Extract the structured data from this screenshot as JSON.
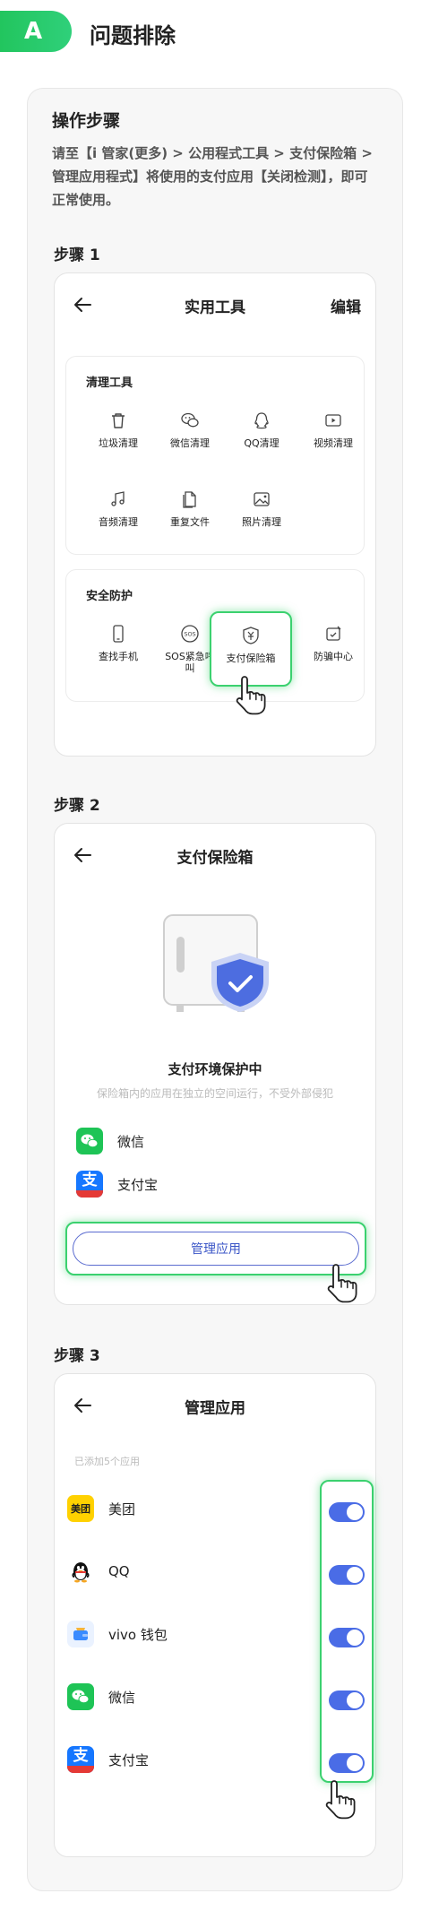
{
  "header": {
    "badge": "A",
    "title": "问题排除"
  },
  "section": {
    "title": "操作步骤",
    "intro": "请至【i 管家(更多) > 公用程式工具 > 支付保险箱 > 管理应用程式】将使用的支付应用【关闭检测】，即可正常使用。"
  },
  "step1": {
    "label": "步骤 1",
    "screen_title": "实用工具",
    "edit_label": "编辑",
    "clean_group": {
      "title": "清理工具",
      "items": [
        "垃圾清理",
        "微信清理",
        "QQ清理",
        "视频清理",
        "音频清理",
        "重复文件",
        "照片清理"
      ]
    },
    "security_group": {
      "title": "安全防护",
      "items": [
        "查找手机",
        "SOS紧急呼叫",
        "支付保险箱",
        "防骗中心"
      ]
    }
  },
  "step2": {
    "label": "步骤 2",
    "screen_title": "支付保险箱",
    "status_title": "支付环境保护中",
    "status_sub": "保险箱内的应用在独立的空间运行，不受外部侵犯",
    "apps": [
      "微信",
      "支付宝"
    ],
    "manage_button": "管理应用"
  },
  "step3": {
    "label": "步骤 3",
    "screen_title": "管理应用",
    "added_note": "已添加5个应用",
    "apps": [
      "美团",
      "QQ",
      "vivo 钱包",
      "微信",
      "支付宝"
    ],
    "toggles": [
      true,
      true,
      true,
      true,
      true
    ],
    "icon_text": {
      "meituan": "美团",
      "alipay": "支"
    }
  },
  "colors": {
    "accent_green": "#22c55e",
    "toggle_blue": "#4a6ce6",
    "button_blue": "#3b56c7"
  }
}
